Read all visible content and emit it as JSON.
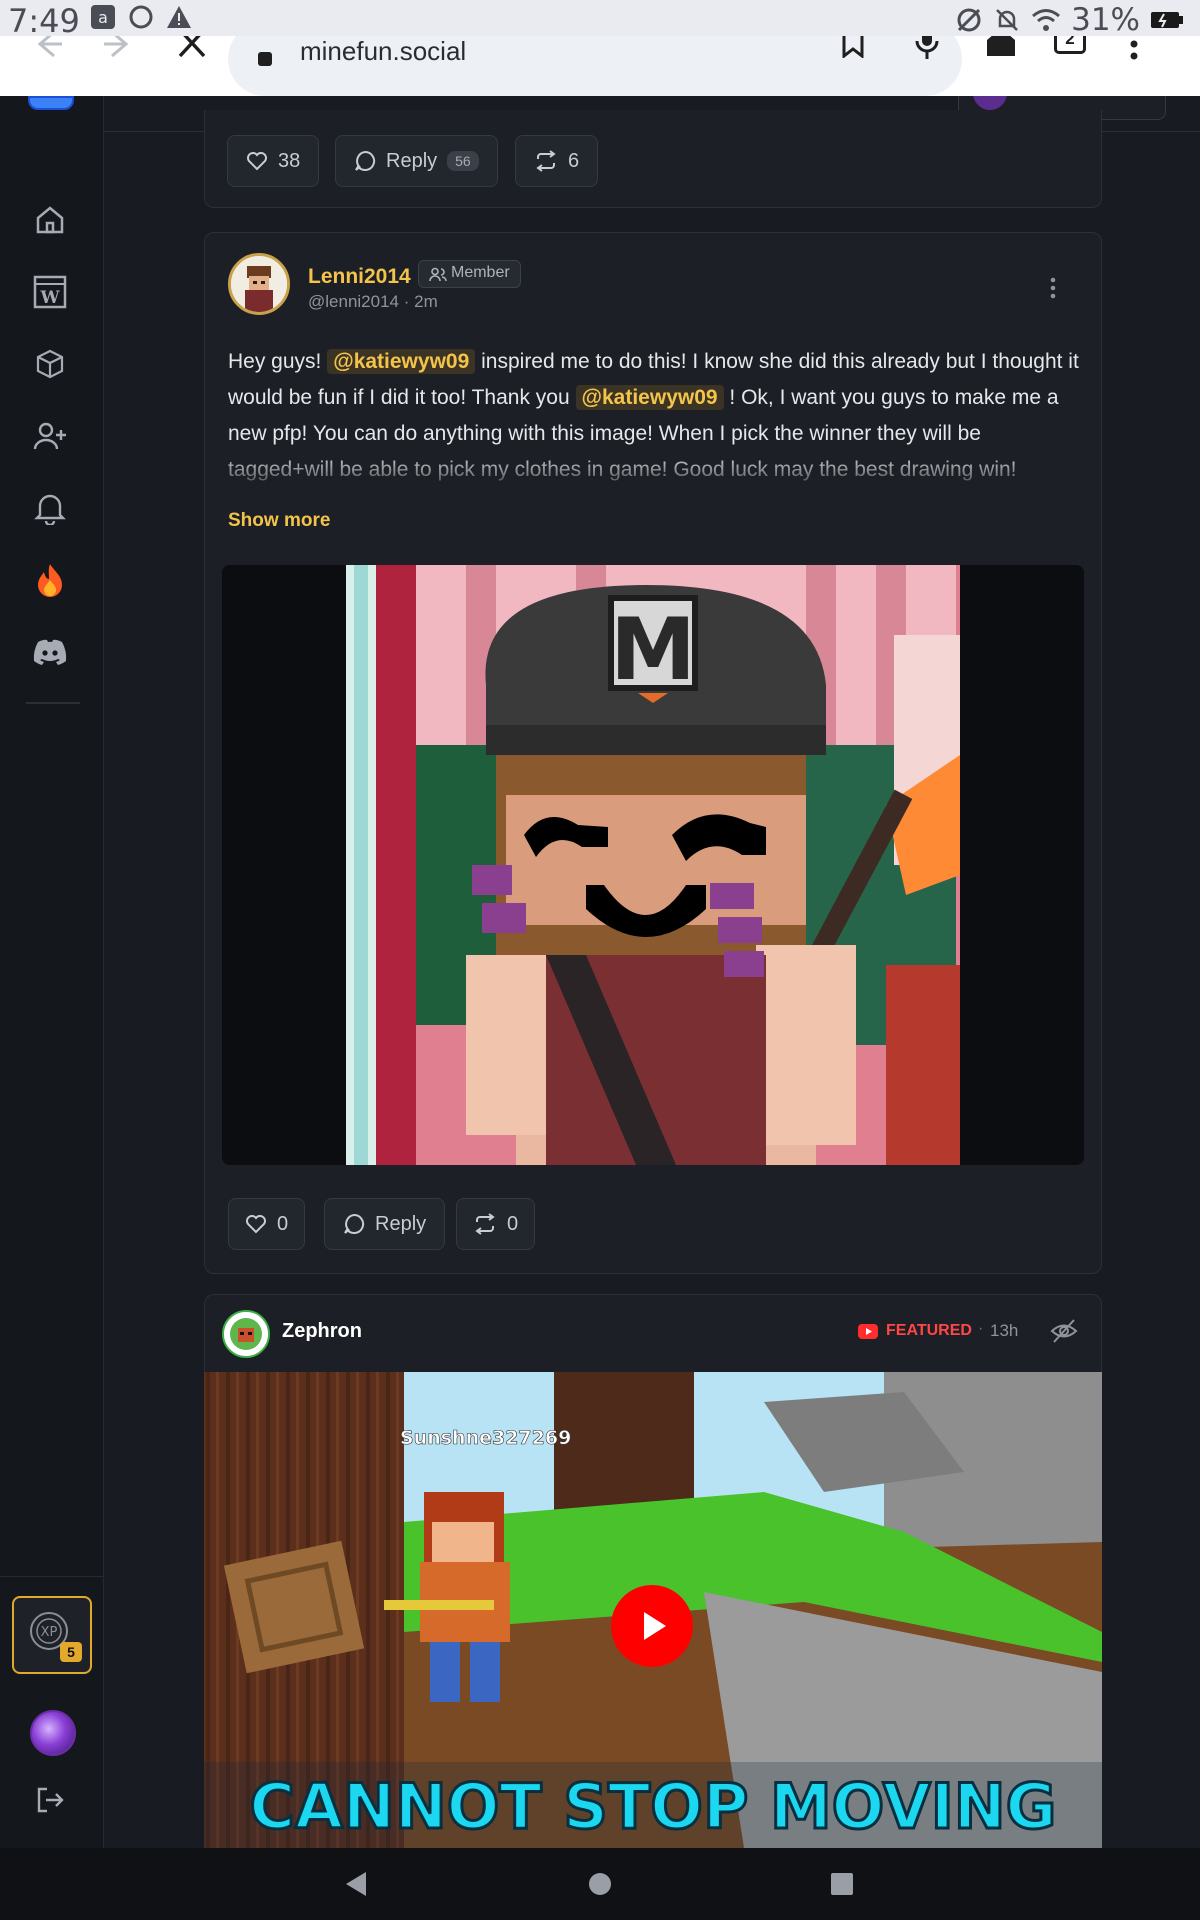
{
  "status_bar": {
    "time": "7:49",
    "battery_percent": "31%",
    "icons": [
      "amazon-icon",
      "circle-icon",
      "warning-icon",
      "data-saver-icon",
      "muted-bell-icon",
      "wifi-icon",
      "battery-icon"
    ]
  },
  "browser": {
    "url": "minefun.social",
    "tab_count": "2",
    "icons": [
      "back-icon",
      "forward-icon",
      "close-icon",
      "site-info-icon",
      "bookmark-icon",
      "mic-icon",
      "home-icon",
      "tabs-icon",
      "menu-icon"
    ]
  },
  "sidebar": {
    "items": [
      {
        "name": "home",
        "icon": "home-icon"
      },
      {
        "name": "wiki",
        "icon": "wiki-icon"
      },
      {
        "name": "cube",
        "icon": "cube-icon"
      },
      {
        "name": "add-friend",
        "icon": "add-user-icon"
      },
      {
        "name": "notifications",
        "icon": "bell-icon"
      },
      {
        "name": "trending",
        "icon": "fire-icon"
      },
      {
        "name": "discord",
        "icon": "discord-icon"
      }
    ],
    "xp": {
      "label": "XP",
      "level": "5"
    },
    "accent": "#e3a92c"
  },
  "prev_post": {
    "likes": "38",
    "reply_label": "Reply",
    "reply_count": "56",
    "reposts": "6"
  },
  "post": {
    "username": "Lenni2014",
    "badge": "Member",
    "handle": "@lenni2014",
    "time": "2m",
    "text_parts": {
      "p1": "Hey guys!",
      "m1": "@katiewyw09",
      "p2": "inspired me to do this! I know she did this already but I thought it would be fun if I did it too! Thank you",
      "m2": "@katiewyw09",
      "p3": "! Ok, I want you guys to make me a new pfp! You can do anything with this image! When I pick the winner they will be tagged+will be able to pick my clothes in game! Good luck may the best drawing win!"
    },
    "show_more": "Show more",
    "hat_letter": "M",
    "likes": "0",
    "reply_label": "Reply",
    "reposts": "0",
    "username_color": "#f3c34a"
  },
  "featured_post": {
    "username": "Zephron",
    "featured_label": "FEATURED",
    "time": "13h",
    "video_player_name": "Sunshne327269",
    "video_title": "CANNOT STOP MOVING",
    "featured_color": "#ff4747"
  },
  "nav_bar": {
    "icons": [
      "back-triangle-icon",
      "home-circle-icon",
      "recents-square-icon"
    ]
  }
}
